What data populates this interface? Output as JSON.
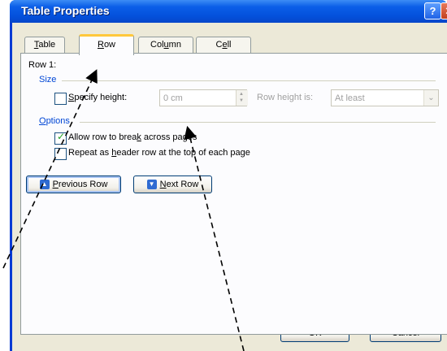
{
  "window": {
    "title": "Table Properties",
    "help_label": "?",
    "close_label": "✕"
  },
  "tabs": [
    {
      "label_pre": "",
      "label_mn": "T",
      "label_post": "able",
      "active": false
    },
    {
      "label_pre": "",
      "label_mn": "R",
      "label_post": "ow",
      "active": true
    },
    {
      "label_pre": "Col",
      "label_mn": "u",
      "label_post": "mn",
      "active": false
    },
    {
      "label_pre": "C",
      "label_mn": "e",
      "label_post": "ll",
      "active": false
    }
  ],
  "panel": {
    "row_title": "Row 1:",
    "size_group": {
      "title": "Size",
      "specify_height": {
        "pre": "",
        "mn": "S",
        "post": "pecify height:",
        "checked": false
      },
      "height_value": "0 cm",
      "row_height_is_label": "Row height is:",
      "row_height_is_value": "At least"
    },
    "options_group": {
      "title_pre": "",
      "title_mn": "O",
      "title_post": "ptions",
      "allow_break": {
        "pre": "Allow row to brea",
        "mn": "k",
        "post": " across pages",
        "checked": true
      },
      "repeat_header": {
        "pre": "Repeat as ",
        "mn": "h",
        "post": "eader row at the top of each page",
        "checked": false
      }
    },
    "prev_row": {
      "pre": "",
      "mn": "P",
      "post": "revious Row"
    },
    "next_row": {
      "pre": "",
      "mn": "N",
      "post": "ext Row"
    }
  },
  "footer": {
    "ok_label": "OK",
    "cancel_label": "Cancel"
  },
  "icons": {
    "prev": "arrow-up-icon",
    "next": "arrow-down-icon"
  }
}
